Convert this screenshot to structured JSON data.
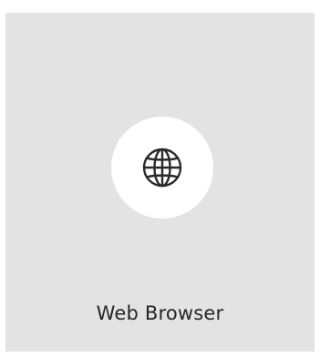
{
  "app_tile": {
    "label": "Web Browser",
    "icon": "globe-icon",
    "colors": {
      "tile_background": "#e3e3e3",
      "icon_circle": "#ffffff",
      "icon_stroke": "#2a2a2a",
      "label_text": "#262626"
    }
  }
}
